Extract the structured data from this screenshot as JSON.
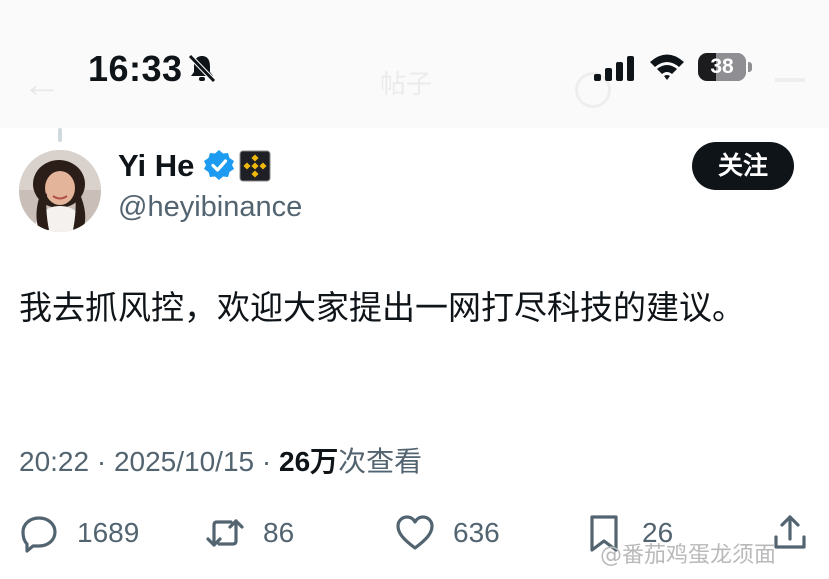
{
  "status_bar": {
    "time": "16:33",
    "battery": "38",
    "battery_percent": 38
  },
  "header": {
    "title": "帖子"
  },
  "author": {
    "name": "Yi He",
    "handle": "@heyibinance",
    "verified": true,
    "affiliation_badge": "binance-icon",
    "follow_label": "关注"
  },
  "tweet": {
    "text": "我去抓风控，欢迎大家提出一网打尽科技的建议。",
    "time": "20:22",
    "separator": "·",
    "date": "2025/10/15",
    "views_count": "26万",
    "views_label": "次查看"
  },
  "actions": {
    "replies": "1689",
    "retweets": "86",
    "likes": "636",
    "bookmarks": "26"
  },
  "watermark": "@番茄鸡蛋龙须面",
  "colors": {
    "text": "#0f1419",
    "secondary": "#536471",
    "verified_blue": "#1d9bf0",
    "binance_gold": "#f0b90b"
  }
}
